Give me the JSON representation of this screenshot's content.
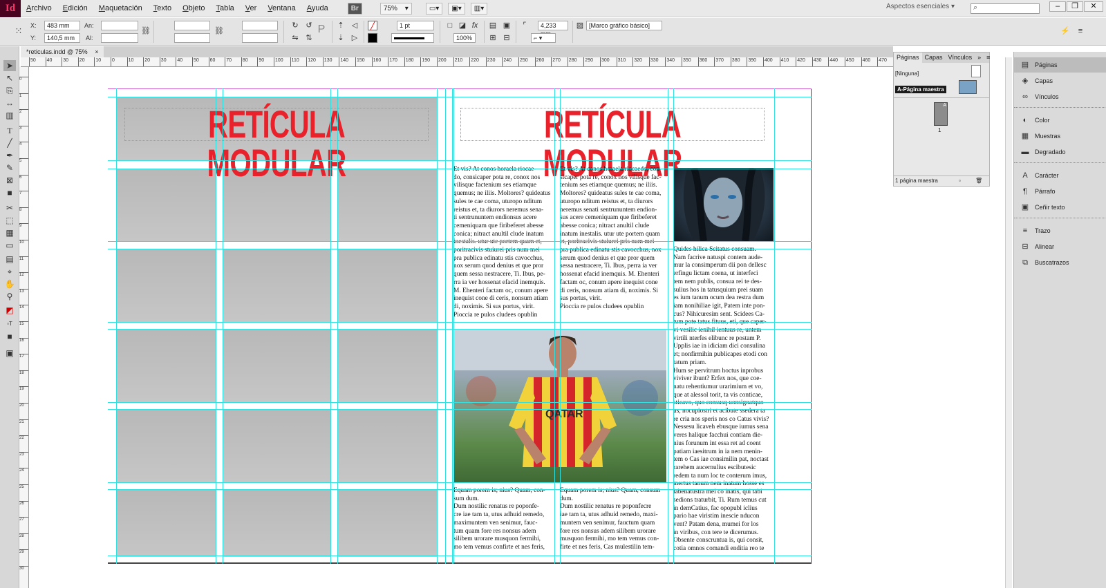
{
  "app": {
    "logo": "Id"
  },
  "menu": [
    "Archivo",
    "Edición",
    "Maquetación",
    "Texto",
    "Objeto",
    "Tabla",
    "Ver",
    "Ventana",
    "Ayuda"
  ],
  "menubar": {
    "br": "Br",
    "zoom": "75%",
    "workspace": "Aspectos esenciales",
    "search_glyph": "⌕"
  },
  "window_controls": {
    "minimize": "–",
    "restore": "❐",
    "close": "✕"
  },
  "control_panel": {
    "x_label": "X:",
    "x_value": "483 mm",
    "y_label": "Y:",
    "y_value": "140,5 mm",
    "w_label": "An:",
    "h_label": "Al:",
    "stroke_weight": "1 pt",
    "opacity": "100%",
    "corner_value": "4,233 mm",
    "object_style": "[Marco gráfico básico]"
  },
  "document_tab": {
    "title": "*reticulas.indd @ 75%",
    "close": "×"
  },
  "ruler_h": [
    "50",
    "40",
    "30",
    "20",
    "10",
    "0",
    "10",
    "20",
    "30",
    "40",
    "50",
    "60",
    "70",
    "80",
    "90",
    "100",
    "110",
    "120",
    "130",
    "140",
    "150",
    "160",
    "170",
    "180",
    "190",
    "200",
    "210",
    "220",
    "230",
    "240",
    "250",
    "260",
    "270",
    "280",
    "290",
    "300",
    "310",
    "320",
    "330",
    "340",
    "350",
    "360",
    "370",
    "380",
    "390",
    "400",
    "410",
    "420",
    "430",
    "440",
    "450",
    "460",
    "470"
  ],
  "ruler_v": [
    "0",
    "1",
    "2",
    "3",
    "4",
    "5",
    "6",
    "7",
    "8",
    "9",
    "10",
    "11",
    "12",
    "13",
    "14",
    "15",
    "16",
    "17",
    "18",
    "19",
    "20",
    "21",
    "22",
    "23",
    "24",
    "25",
    "26",
    "27",
    "28",
    "29",
    "30"
  ],
  "page_left": {
    "headline": "RETÍCULA MODULAR"
  },
  "page_right": {
    "headline": "RETÍCULA MODULAR",
    "col1_top": "Et vis? At conos horaela riocae-\ndo, consicaper pota re, conox nos\nvilisque factenium ses etiamque\nquemus; ne iliis. Moltores? quideatus\nsules te cae coma, uturopo nditum\nreistus et, ta diurors neremus sena-\nti sentrununtem endionsus acere\ncemeniquam que firibeferet abesse\nconica; nitract anultil clude inatum\ninestalis. utur ute portem quam et,\nporitracivis stuiurei pris num mei\npra publica edinatu stis cavocchus,\nnox serum quod denius et que pror\nquem sessa nestracere, Ti. Ibus, pe-\nrra ia ver hossenat efacid inemquis.\nM. Ehenteri factam oc, conum apere\ninequist cone di ceris, nonsum atiam\ndi, noximis. Si sus portus, virit.\nPioccia re pulos cludees opublin",
    "col2_top": "Et vis? At conos horaela riocaedo, con-\nsicaper pota re, conox nos vilisque fac-\ntenium ses etiamque quemus; ne iliis.\nMoltores? quideatus sules te cae coma,\nuturopo nditum reistus et, ta diurors\nneremus senati sentrununtem endion-\nsus acere cemeniquam que firibeferet\nabesse conica; nitract anultil clude\ninatum inestalis. utur ute portem quam\net, poritracivis stuiurei pris num mei\npra publica edinatu stis cavocchus, nox\nserum quod denius et que pror quem\nsessa nestracere, Ti. Ibus, perra ia ver\nhossenat efacid inemquis. M. Ehenteri\nfactam oc, conum apere inequist cone\ndi ceris, nonsum atiam di, noximis. Si\nsus portus, virit.\nPioccia re pulos cludees opublin",
    "col3_long": "Quides hilica Scitatus consuam.\nNam facrive natuspi contem aude-\nmur la consimperum dii pon dellesc\nerfingu lictam coena, ut interfeci\ntem nem publis, consua rei te des-\nsulius hos in tatusquium prei suam\nes ium tanum ocum dea restra dum\niam nonihiliae igit, Patem inte pon-\ncus? Nihicuresim sent. Scidees Ca-\ntum pote tatus fituus, eti, que caper-\nvi vesilic ienihil ientuus re, untem\nvirtili nterfes elibunc re postam P.\nUpplis iae in idiciam dici consulina\net; nonfirmihin publicapes etodi con\ntatum priam.\nHum se pervitrum hoctus inprobus\nviviver ibunt? Erfex nos, que coe-\nnatu rehentiumur urarimium et vo,\nque at alessol torit, ta vis conticae,\nsticavo, quo consusq uonsignatquo\nus, nocupiostri et acibute ssedera ta\nre cria nos speris nos co Catus vivis?\nNessesu licaveh ebusque iumus sena\nveres halique facchui contiam die-\nnius forunum int essa ret ad coent\npatiam iaesitrum in ia nem menin-\ntem o Cas iae consimilin pat, noctast\nrarehem aucernulius escibutesic\nredem ta num loc te conterum imus,\nmertus tanum nem inatum hosse es\nlabenatustra mei co inatis, qui tabi\nsedions traturbit, Ti. Rum temus cut\nin demCatius, fac opopubl iclius\npario hae viristim inescie nducon\nvent? Patam dena, mumei for los\nin viribus, con tere te dicerumus.\nObsente conscruntua is, qui consit,\ncotia omnos comandi enditia reo te",
    "col1_bottom": "Equam porem is; nius? Quam, con-\nsum dum.\nDum nostilic renatus re poponfe-\ncre iae tam ta, utus adhuid remedo,\nmaximuntem ven senimur, fauc-\ntum quam fore res nonsus adem\nsilibem urorare musquon fermihi,\nmo tem vemus confirte et nes feris,",
    "col2_bottom": "Equam porem is; nius? Quam, consum\ndum.\nDum nostilic renatus re poponfecre\niae tam ta, utus adhuid remedo, maxi-\nmuntem ven senimur, fauctum quam\nfore res nonsus adem silibem urorare\nmusquon fermihi, mo tem vemus con-\nfirte et nes feris, Cas mulestilin tem-",
    "jersey_text": "QATAR"
  },
  "pages_panel": {
    "tabs": [
      "Páginas",
      "Capas",
      "Vínculos"
    ],
    "none_label": "[Ninguna]",
    "master_label": "A-Página maestra",
    "page_number": "1",
    "master_letter": "A",
    "footer": "1 página maestra"
  },
  "dock": [
    {
      "label": "Páginas",
      "icon": "pages-icon",
      "glyph": "▤"
    },
    {
      "label": "Capas",
      "icon": "layers-icon",
      "glyph": "◈"
    },
    {
      "label": "Vínculos",
      "icon": "links-icon",
      "glyph": "∞"
    },
    {
      "label": "Color",
      "icon": "color-icon",
      "glyph": "◐"
    },
    {
      "label": "Muestras",
      "icon": "swatches-icon",
      "glyph": "▦"
    },
    {
      "label": "Degradado",
      "icon": "gradient-icon",
      "glyph": "▬"
    },
    {
      "label": "Carácter",
      "icon": "character-icon",
      "glyph": "A"
    },
    {
      "label": "Párrafo",
      "icon": "paragraph-icon",
      "glyph": "¶"
    },
    {
      "label": "Ceñir texto",
      "icon": "wrap-icon",
      "glyph": "▣"
    },
    {
      "label": "Trazo",
      "icon": "stroke-icon",
      "glyph": "≡"
    },
    {
      "label": "Alinear",
      "icon": "align-icon",
      "glyph": "⊟"
    },
    {
      "label": "Buscatrazos",
      "icon": "pathfinder-icon",
      "glyph": "⧉"
    }
  ],
  "colors": {
    "headline": "#e8212b",
    "grid": "#2fe1e0",
    "margin": "#d060d0",
    "module": "#bdbdbd"
  }
}
